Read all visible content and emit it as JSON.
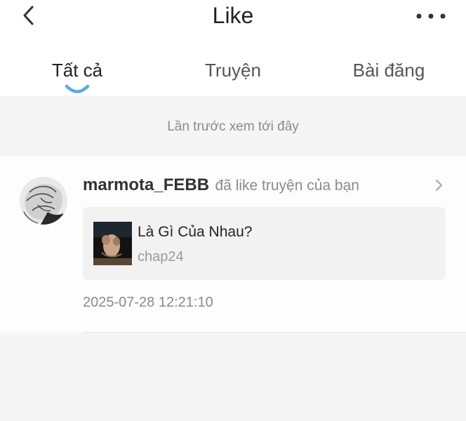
{
  "header": {
    "title": "Like",
    "back_icon": "chevron-left-icon",
    "more_icon": "more-horizontal-icon"
  },
  "tabs": [
    {
      "label": "Tất cả",
      "active": true
    },
    {
      "label": "Truyện",
      "active": false
    },
    {
      "label": "Bài đăng",
      "active": false
    }
  ],
  "last_seen_note": "Lần trước xem tới đây",
  "notifications": [
    {
      "username": "marmota_FEBB",
      "action": "đã like truyện của bạn",
      "story": {
        "title": "Là Gì Của Nhau?",
        "chapter": "chap24"
      },
      "timestamp": "2025-07-28 12:21:10"
    }
  ],
  "colors": {
    "accent": "#5aa9e6",
    "primary_text": "#222222",
    "secondary_text": "#8a8a8a",
    "background": "#f5f5f5"
  }
}
